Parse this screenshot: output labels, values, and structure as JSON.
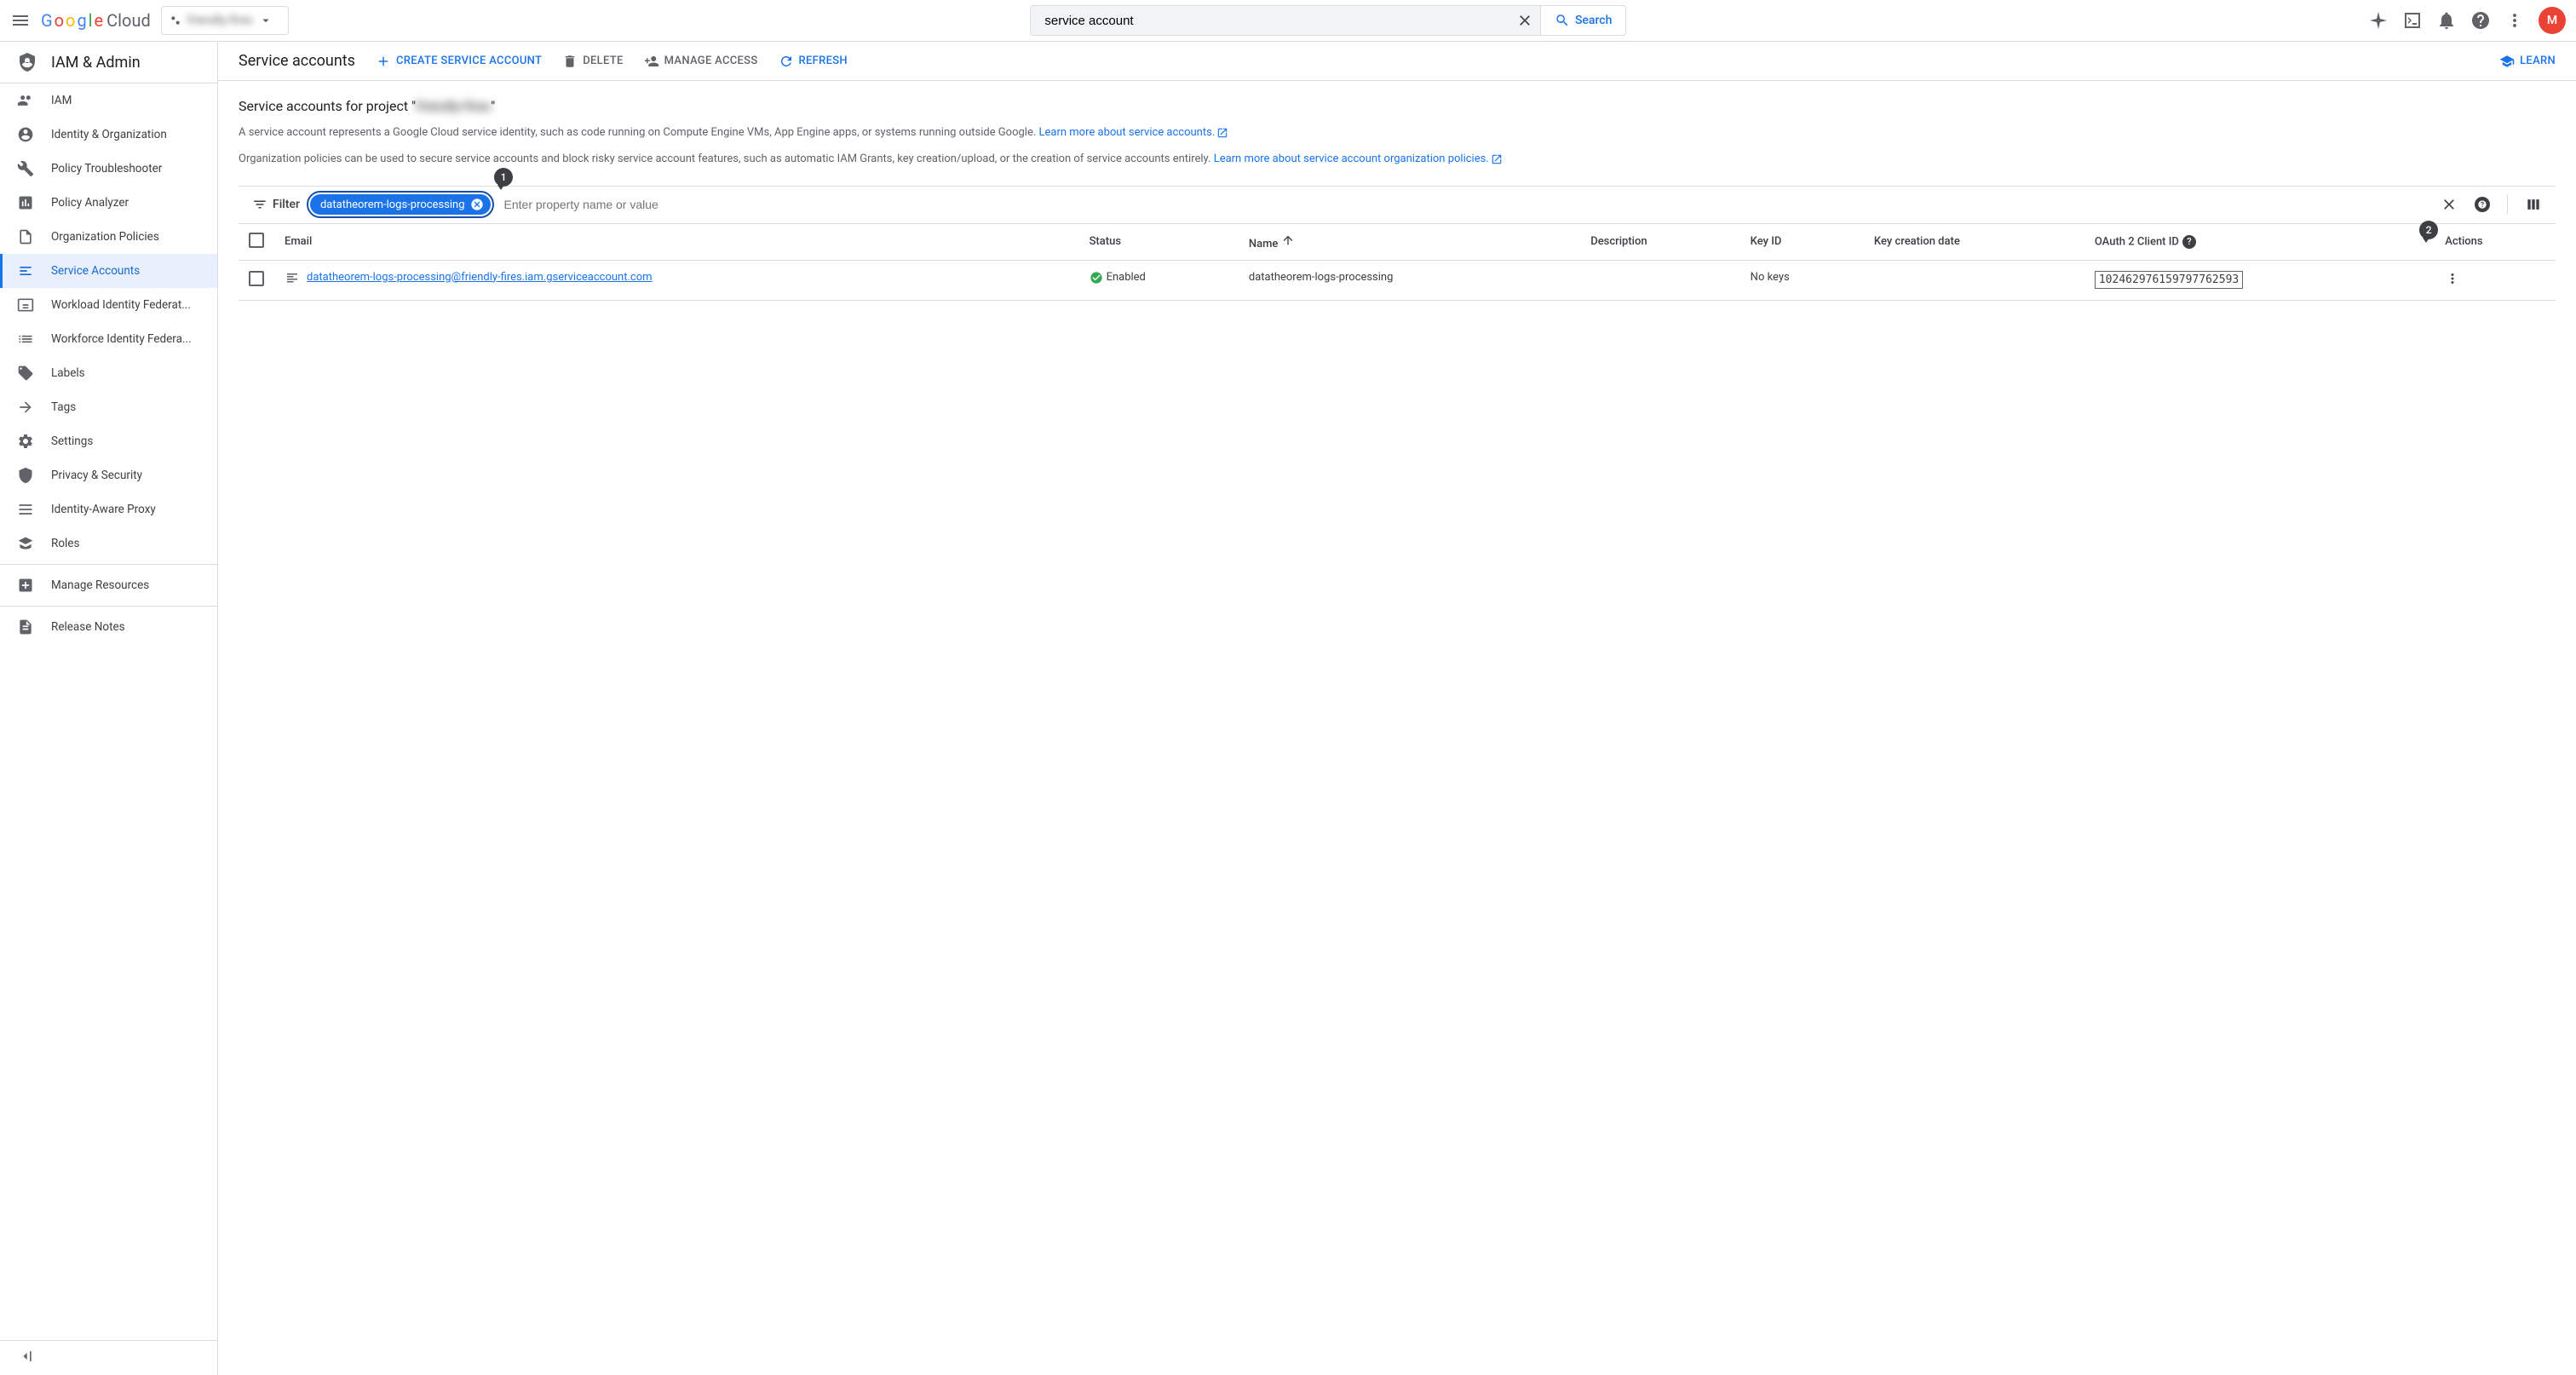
{
  "topbar": {
    "logo_text": "Google",
    "logo_cloud": "Cloud",
    "project_name": "friendly-fires",
    "search_value": "service account",
    "search_button": "Search",
    "avatar_letter": "M"
  },
  "section_title": "IAM & Admin",
  "nav": [
    {
      "icon": "people",
      "label": "IAM"
    },
    {
      "icon": "account",
      "label": "Identity & Organization"
    },
    {
      "icon": "wrench",
      "label": "Policy Troubleshooter"
    },
    {
      "icon": "analyzer",
      "label": "Policy Analyzer"
    },
    {
      "icon": "page",
      "label": "Organization Policies"
    },
    {
      "icon": "sa",
      "label": "Service Accounts",
      "active": true
    },
    {
      "icon": "wif",
      "label": "Workload Identity Federat..."
    },
    {
      "icon": "list",
      "label": "Workforce Identity Federa..."
    },
    {
      "icon": "tag",
      "label": "Labels"
    },
    {
      "icon": "arrow",
      "label": "Tags"
    },
    {
      "icon": "gear",
      "label": "Settings"
    },
    {
      "icon": "shield",
      "label": "Privacy & Security"
    },
    {
      "icon": "iap",
      "label": "Identity-Aware Proxy"
    },
    {
      "icon": "hat",
      "label": "Roles"
    }
  ],
  "nav_footer": [
    {
      "icon": "med",
      "label": "Manage Resources"
    },
    {
      "icon": "notes",
      "label": "Release Notes"
    }
  ],
  "page": {
    "title": "Service accounts",
    "actions": {
      "create": "CREATE SERVICE ACCOUNT",
      "delete": "DELETE",
      "manage": "MANAGE ACCESS",
      "refresh": "REFRESH",
      "learn": "LEARN"
    },
    "subtitle_prefix": "Service accounts for project \"",
    "subtitle_project": "friendly-fires",
    "subtitle_suffix": "\"",
    "desc1_a": "A service account represents a Google Cloud service identity, such as code running on Compute Engine VMs, App Engine apps, or systems running outside Google. ",
    "desc1_link": "Learn more about service accounts.",
    "desc2_a": "Organization policies can be used to secure service accounts and block risky service account features, such as automatic IAM Grants, key creation/upload, or the creation of service accounts entirely. ",
    "desc2_link": "Learn more about service account organization policies."
  },
  "filter": {
    "label": "Filter",
    "chip": "datatheorem-logs-processing",
    "placeholder": "Enter property name or value"
  },
  "table": {
    "headers": {
      "email": "Email",
      "status": "Status",
      "name": "Name",
      "description": "Description",
      "keyid": "Key ID",
      "keycreation": "Key creation date",
      "oauth": "OAuth 2 Client ID",
      "actions": "Actions"
    },
    "row": {
      "email": "datatheorem-logs-processing@friendly-fires.iam.gserviceaccount.com",
      "status": "Enabled",
      "name": "datatheorem-logs-processing",
      "description": "",
      "keyid": "No keys",
      "keycreation": "",
      "oauth": "102462976159797762593"
    }
  },
  "bubbles": {
    "one": "1",
    "two": "2"
  }
}
